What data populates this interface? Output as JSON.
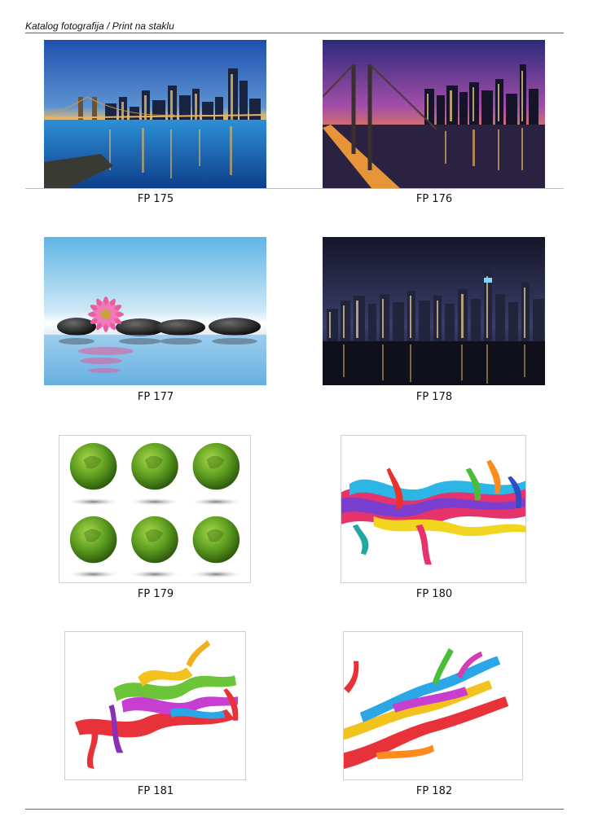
{
  "header": {
    "title": "Katalog fotografija / Print na staklu"
  },
  "items": [
    {
      "code": "FP 175",
      "subject": "city-bridge-dusk"
    },
    {
      "code": "FP 176",
      "subject": "bay-bridge-night"
    },
    {
      "code": "FP 177",
      "subject": "pink-flower-stones"
    },
    {
      "code": "FP 178",
      "subject": "skyline-night"
    },
    {
      "code": "FP 179",
      "subject": "green-globes"
    },
    {
      "code": "FP 180",
      "subject": "color-splash-band"
    },
    {
      "code": "FP 181",
      "subject": "color-splash-center"
    },
    {
      "code": "FP 182",
      "subject": "color-splash-corner"
    }
  ]
}
